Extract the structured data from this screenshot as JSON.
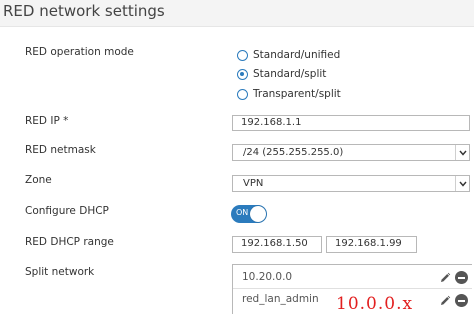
{
  "page": {
    "title": "RED network settings"
  },
  "operation_mode": {
    "label": "RED operation mode",
    "options": [
      {
        "label": "Standard/unified",
        "selected": false
      },
      {
        "label": "Standard/split",
        "selected": true
      },
      {
        "label": "Transparent/split",
        "selected": false
      }
    ]
  },
  "red_ip": {
    "label": "RED IP *",
    "value": "192.168.1.1"
  },
  "red_netmask": {
    "label": "RED netmask",
    "value": "/24 (255.255.255.0)"
  },
  "zone": {
    "label": "Zone",
    "value": "VPN"
  },
  "configure_dhcp": {
    "label": "Configure DHCP",
    "toggle_text": "ON",
    "enabled": true
  },
  "dhcp_range": {
    "label": "RED DHCP range",
    "start": "192.168.1.50",
    "end": "192.168.1.99"
  },
  "split_network": {
    "label": "Split network",
    "items": [
      "10.20.0.0",
      "red_lan_admin"
    ],
    "handwritten_note": "10.0.0.x"
  },
  "colors": {
    "accent": "#2b7bbd",
    "annotation": "#e21f1f"
  }
}
